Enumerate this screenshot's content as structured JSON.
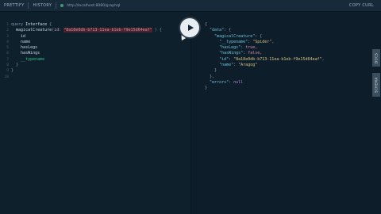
{
  "toolbar": {
    "prettify_label": "PRETTIFY",
    "history_label": "HISTORY",
    "url": "http://localhost:8080/graphql",
    "copy_curl_label": "COPY CURL"
  },
  "side_tabs": {
    "docs_label": "DOCS",
    "schema_label": "SCHEMA"
  },
  "editor": {
    "line_numbers": [
      "1",
      "2",
      "3",
      "4",
      "5",
      "6",
      "7",
      "8",
      "9",
      "10"
    ],
    "line1": {
      "keyword": "query",
      "name": "Interface",
      "brace": "{"
    },
    "line2": {
      "field": "magicalCreature",
      "paren": "(",
      "arg_name": "id",
      "colon": ":",
      "arg_value": "\"8a18e0db-b713-11ea-b1eb-f9e15d64eaf\"",
      "close": ") {"
    },
    "fields": [
      "id",
      "name",
      "hasLegs",
      "hasWings"
    ],
    "meta_field": "__typename",
    "close_inner": "}",
    "close_outer": "}"
  },
  "result": {
    "open": "{",
    "data_key": "\"data\"",
    "magical_key": "\"magicalCreature\"",
    "typename_key": "\"__typename\"",
    "typename_val": "\"Spider\"",
    "haslegs_key": "\"hasLegs\"",
    "haslegs_val": "true,",
    "haswings_key": "\"hasWings\"",
    "haswings_val": "false,",
    "id_key": "\"id\"",
    "id_val": "\"8a18e0db-b713-11ea-b1eb-f9e15d64eaf\"",
    "name_key": "\"name\"",
    "name_val": "\"Aragog\"",
    "errors_key": "\"errors\"",
    "errors_val": "null",
    "close": "}"
  },
  "colors": {
    "background": "#0f202d",
    "accent": "#2fbf8a"
  }
}
